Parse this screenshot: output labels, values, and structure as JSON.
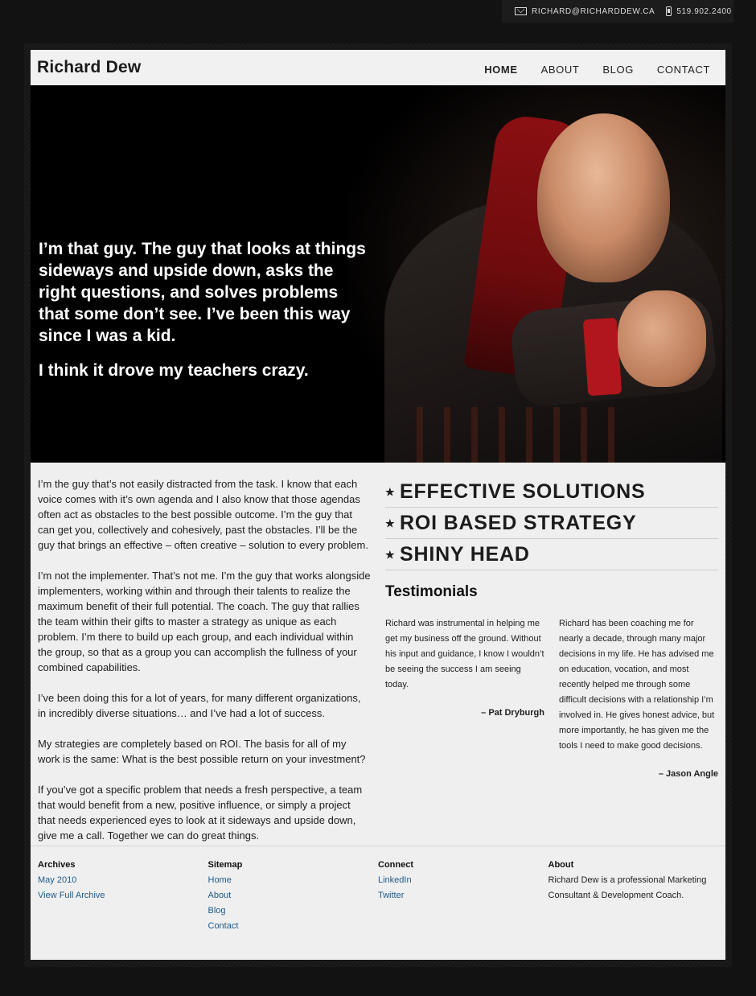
{
  "topbar": {
    "email": "RICHARD@RICHARDDEW.CA",
    "phone": "519.902.2400",
    "email_icon": "mail-icon",
    "phone_icon": "phone-icon"
  },
  "header": {
    "logo": "Richard Dew",
    "nav": [
      "HOME",
      "ABOUT",
      "BLOG",
      "CONTACT"
    ],
    "active": "HOME"
  },
  "hero": {
    "quote_1": "I’m that guy. The guy that looks at things sideways and upside down, asks the right questions, and solves problems that some don’t see. I’ve been this way since I was a kid.",
    "quote_2": "I think it drove my teachers crazy."
  },
  "intro": [
    "I’m the guy that’s not easily distracted from the task. I know that each voice comes with it’s own agenda and I also know that those agendas often act as obstacles to the best possible outcome. I’m the guy that can get you, collectively and cohesively, past the obstacles. I’ll be the guy that brings an effective – often creative – solution to every problem.",
    "I’m not the implementer. That’s not me. I’m the guy that works alongside implementers, working within and through their talents to realize the maximum benefit of their full potential. The coach. The guy that rallies the team within their gifts to master a strategy as unique as each problem. I’m there to build up each group, and each individual within the group, so that as a group you can accomplish the fullness of your combined capabilities.",
    "I’ve been doing this for a lot of years, for many different organizations, in incredibly diverse situations… and I’ve had a lot of success.",
    "My strategies are completely based on ROI. The basis for all of my work is the same: What is the best possible return on your investment?",
    "If you’ve got a specific problem that needs a fresh perspective, a team that would benefit from a new, positive influence, or simply a project that needs experienced eyes to look at it sideways and upside down, give me a call. Together we can do great things."
  ],
  "features": [
    "EFFECTIVE SOLUTIONS",
    "ROI BASED STRATEGY",
    "SHINY HEAD"
  ],
  "testimonials": {
    "title": "Testimonials",
    "items": [
      {
        "text": "Richard was instrumental in helping me get my business off the ground. Without his input and guidance, I know I wouldn’t be seeing the success I am seeing today.",
        "author": "– Pat Dryburgh"
      },
      {
        "text": "Richard has been coaching me for nearly a decade, through many major decisions in my life. He has advised me on education, vocation, and most recently helped me through some difficult decisions with a relationship I’m involved in. He gives honest advice, but more importantly, he has given me the tools I need to make good decisions.",
        "author": "– Jason Angle"
      }
    ]
  },
  "footer": {
    "archives": {
      "title": "Archives",
      "links": [
        "May 2010",
        "View Full Archive"
      ]
    },
    "sitemap": {
      "title": "Sitemap",
      "links": [
        "Home",
        "About",
        "Blog",
        "Contact"
      ]
    },
    "connect": {
      "title": "Connect",
      "links": [
        "LinkedIn",
        "Twitter"
      ]
    },
    "about": {
      "title": "About",
      "text": "Richard Dew is a professional Marketing Consultant & Development Coach."
    }
  }
}
